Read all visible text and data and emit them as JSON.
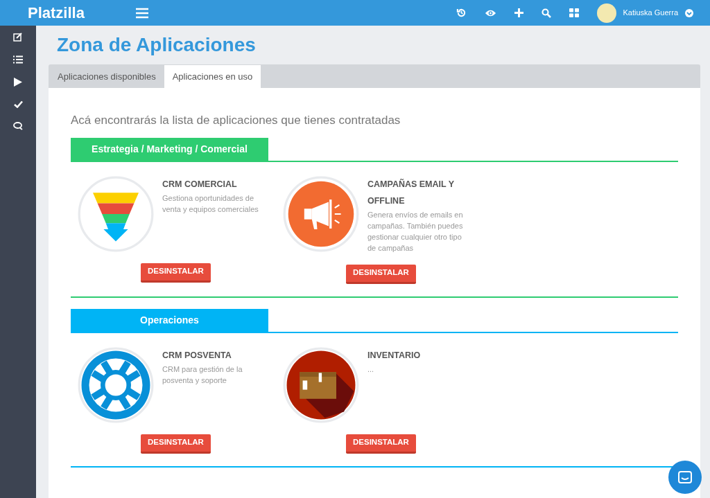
{
  "topbar": {
    "logo": "Platzilla",
    "user": "Katiuska Guerra"
  },
  "page_title": "Zona de Aplicaciones",
  "tabs": [
    {
      "label": "Aplicaciones disponibles",
      "selected": false
    },
    {
      "label": "Aplicaciones en uso",
      "selected": true
    }
  ],
  "intro": "Acá encontrarás la lista de aplicaciones que tienes contratadas",
  "sections": [
    {
      "title": "Estrategia / Marketing / Comercial",
      "color": "#2ecc71",
      "apps": [
        {
          "kind": "funnel",
          "name": "CRM COMERCIAL",
          "description": "Gestiona oportunidades de venta y equipos comerciales",
          "button": "DESINSTALAR"
        },
        {
          "kind": "megaphone",
          "name": "CAMPAÑAS EMAIL Y OFFLINE",
          "description": "Genera envíos de emails en campañas. También puedes gestionar cualquier otro tipo de campañas",
          "button": "DESINSTALAR"
        }
      ]
    },
    {
      "title": "Operaciones",
      "color": "#00b4f5",
      "apps": [
        {
          "kind": "lifebuoy",
          "name": "CRM POSVENTA",
          "description": "CRM para gestión de la posventa y soporte",
          "button": "DESINSTALAR"
        },
        {
          "kind": "box",
          "name": "INVENTARIO",
          "description": "...",
          "button": "DESINSTALAR"
        }
      ]
    }
  ]
}
